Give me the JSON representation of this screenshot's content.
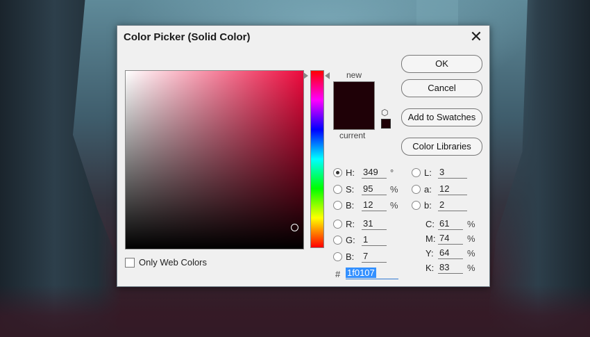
{
  "dialog": {
    "title": "Color Picker (Solid Color)",
    "close_icon": "close-icon"
  },
  "preview": {
    "new_label": "new",
    "current_label": "current",
    "new_color": "#1f0107",
    "current_color": "#1f0107",
    "cube_icon": "cube-icon"
  },
  "buttons": {
    "ok": "OK",
    "cancel": "Cancel",
    "add_swatches": "Add to Swatches",
    "color_libraries": "Color Libraries"
  },
  "hsb": {
    "h": {
      "label": "H:",
      "value": "349",
      "unit": "°"
    },
    "s": {
      "label": "S:",
      "value": "95",
      "unit": "%"
    },
    "b": {
      "label": "B:",
      "value": "12",
      "unit": "%"
    }
  },
  "rgb": {
    "r": {
      "label": "R:",
      "value": "31"
    },
    "g": {
      "label": "G:",
      "value": "1"
    },
    "b": {
      "label": "B:",
      "value": "7"
    }
  },
  "lab": {
    "l": {
      "label": "L:",
      "value": "3"
    },
    "a": {
      "label": "a:",
      "value": "12"
    },
    "b": {
      "label": "b:",
      "value": "2"
    }
  },
  "cmyk": {
    "c": {
      "label": "C:",
      "value": "61",
      "unit": "%"
    },
    "m": {
      "label": "M:",
      "value": "74",
      "unit": "%"
    },
    "y": {
      "label": "Y:",
      "value": "64",
      "unit": "%"
    },
    "k": {
      "label": "K:",
      "value": "83",
      "unit": "%"
    }
  },
  "hex": {
    "label": "#",
    "value": "1f0107"
  },
  "web_only": {
    "label": "Only Web Colors",
    "checked": false
  },
  "field": {
    "hue_color": "#ed0a3d"
  }
}
